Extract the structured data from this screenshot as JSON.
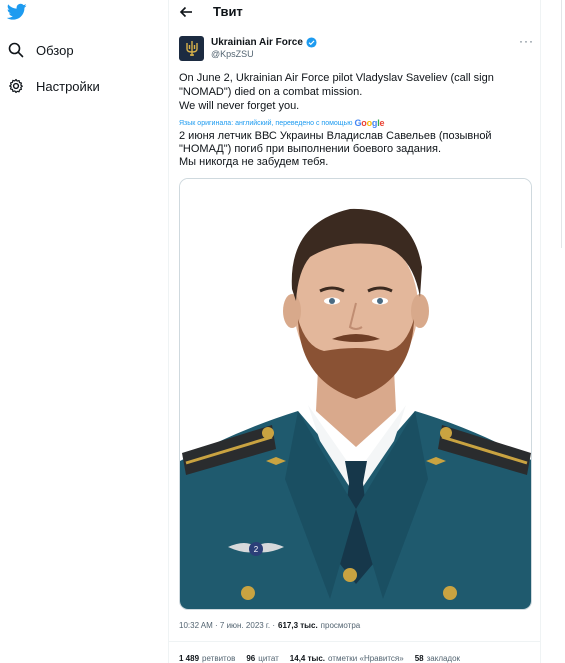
{
  "sidebar": {
    "items": [
      {
        "label": "Обзор",
        "icon": "search-icon"
      },
      {
        "label": "Настройки",
        "icon": "gear-icon"
      }
    ]
  },
  "header": {
    "title": "Твит"
  },
  "tweet": {
    "author_name": "Ukrainian Air Force",
    "author_handle": "@KpsZSU",
    "text_lines": [
      "On June 2, Ukrainian Air Force pilot Vladyslav Saveliev (call sign \"NOMAD\") died on a combat mission.",
      "We will never forget you."
    ],
    "translation_note": "Язык оригинала: английский, переведено с помощью",
    "translation_provider": "Google",
    "translated_lines": [
      "2 июня летчик ВВС Украины Владислав Савельев (позывной \"НОМАД\") погиб при выполнении боевого задания.",
      "Мы никогда не забудем тебя."
    ],
    "time": "10:32 AM · 7 июн. 2023 г.",
    "views_count": "617,3 тыс.",
    "views_label": "просмотра",
    "stats": [
      {
        "num": "1 489",
        "label": "ретвитов"
      },
      {
        "num": "96",
        "label": "цитат"
      },
      {
        "num": "14,4 тыс.",
        "label": "отметки «Нравится»"
      },
      {
        "num": "58",
        "label": "закладок"
      }
    ]
  },
  "colors": {
    "accent": "#1d9bf0",
    "text": "#0f1419",
    "muted": "#536471",
    "uniform": "#1f5a6e",
    "epaulette": "#2a2c2e",
    "gold": "#c9a341"
  }
}
